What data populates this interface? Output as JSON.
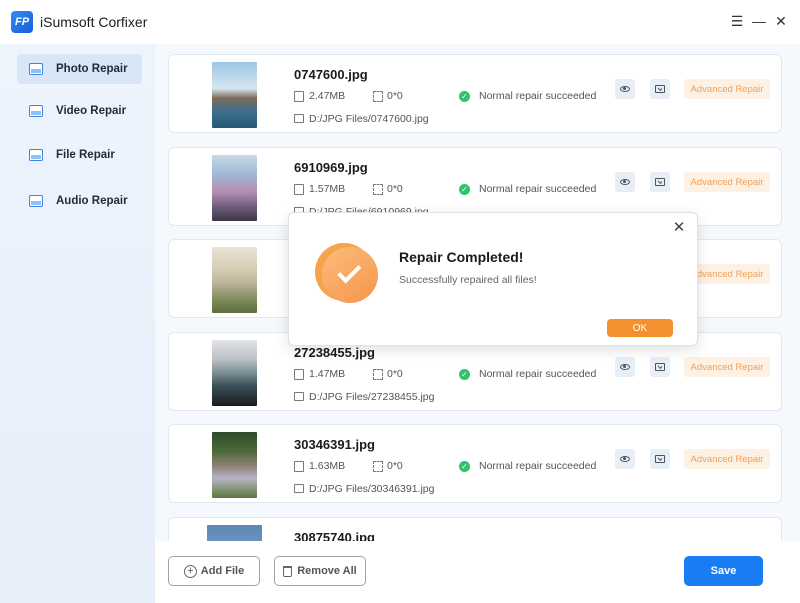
{
  "app": {
    "title": "iSumsoft Corfixer",
    "logo_text": "FP"
  },
  "window_controls": {
    "menu": "☰",
    "minimize": "—",
    "close": "✕"
  },
  "sidebar": {
    "items": [
      {
        "label": "Photo Repair",
        "active": true
      },
      {
        "label": "Video Repair",
        "active": false
      },
      {
        "label": "File Repair",
        "active": false
      },
      {
        "label": "Audio Repair",
        "active": false
      }
    ]
  },
  "files": [
    {
      "name": "0747600.jpg",
      "size": "2.47MB",
      "dimensions": "0*0",
      "status": "Normal repair succeeded",
      "path": "D:/JPG Files/0747600.jpg",
      "action": "Advanced Repair"
    },
    {
      "name": "6910969.jpg",
      "size": "1.57MB",
      "dimensions": "0*0",
      "status": "Normal repair succeeded",
      "path": "D:/JPG Files/6910969.jpg",
      "action": "Advanced Repair"
    },
    {
      "name": "",
      "size": "",
      "dimensions": "",
      "status": "",
      "path": "",
      "action": "Advanced Repair"
    },
    {
      "name": "27238455.jpg",
      "size": "1.47MB",
      "dimensions": "0*0",
      "status": "Normal repair succeeded",
      "path": "D:/JPG Files/27238455.jpg",
      "action": "Advanced Repair"
    },
    {
      "name": "30346391.jpg",
      "size": "1.63MB",
      "dimensions": "0*0",
      "status": "Normal repair succeeded",
      "path": "D:/JPG Files/30346391.jpg",
      "action": "Advanced Repair"
    },
    {
      "name": "30875740.jpg",
      "size": "",
      "dimensions": "",
      "status": "",
      "path": "",
      "action": ""
    }
  ],
  "footer": {
    "add_file": "Add File",
    "remove_all": "Remove All",
    "save": "Save"
  },
  "dialog": {
    "title": "Repair Completed!",
    "message": "Successfully repaired all files!",
    "ok": "OK",
    "close": "✕"
  },
  "colors": {
    "accent": "#1a7cf3",
    "success": "#2ec46a",
    "warning": "#f5902f"
  }
}
